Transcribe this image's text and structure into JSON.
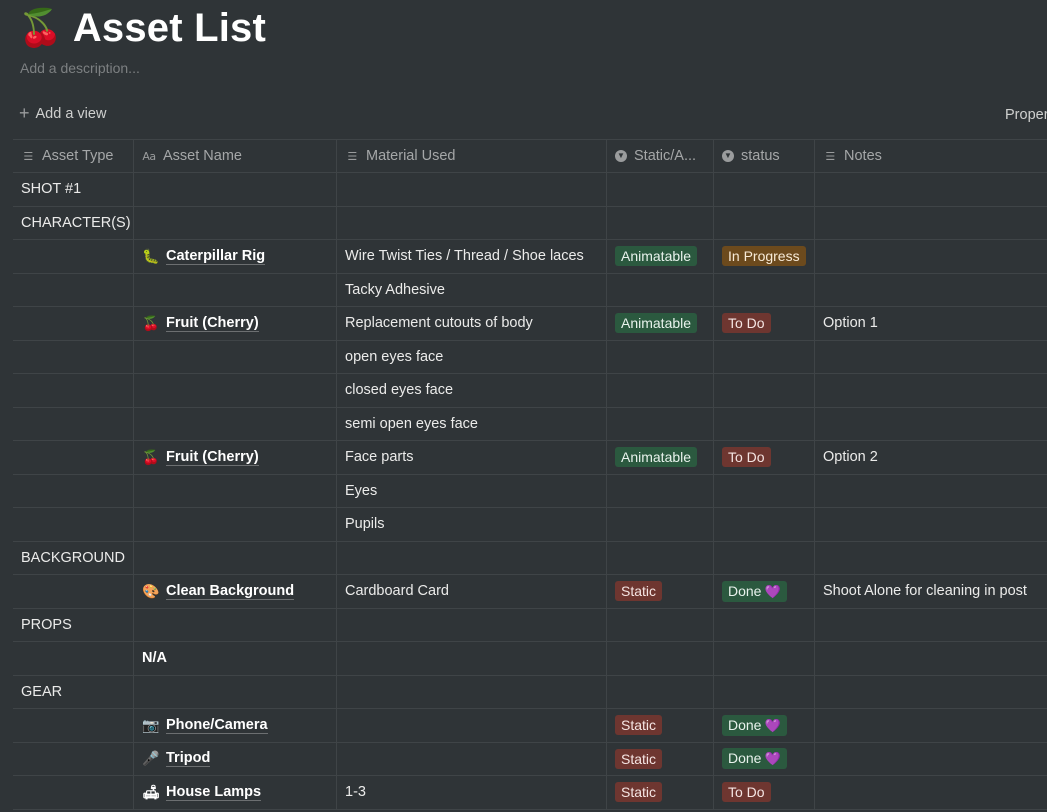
{
  "page": {
    "emoji": "🍒",
    "title": "Asset List",
    "description_placeholder": "Add a description...",
    "add_view": "Add a view",
    "properties": "Proper"
  },
  "columns": [
    {
      "label": "Asset Type",
      "icon": "text-lines-icon"
    },
    {
      "label": "Asset Name",
      "icon": "title-aa-icon"
    },
    {
      "label": "Material Used",
      "icon": "text-lines-icon"
    },
    {
      "label": "Static/A...",
      "icon": "select-chevron-icon"
    },
    {
      "label": "status",
      "icon": "select-chevron-icon"
    },
    {
      "label": "Notes",
      "icon": "text-lines-icon"
    }
  ],
  "rows": [
    {
      "type": "SHOT #1",
      "emoji": "",
      "name": "",
      "material": "",
      "static": "",
      "status": "",
      "notes": ""
    },
    {
      "type": "CHARACTER(S)",
      "emoji": "",
      "name": "",
      "material": "",
      "static": "",
      "status": "",
      "notes": ""
    },
    {
      "type": "",
      "emoji": "🐛",
      "name": "Caterpillar Rig",
      "material": "Wire Twist Ties / Thread / Shoe laces",
      "static": "Animatable",
      "status": "In Progress",
      "notes": ""
    },
    {
      "type": "",
      "emoji": "",
      "name": "",
      "material": "Tacky Adhesive",
      "static": "",
      "status": "",
      "notes": ""
    },
    {
      "type": "",
      "emoji": "🍒",
      "name": "Fruit (Cherry)",
      "material": "Replacement cutouts of body",
      "static": "Animatable",
      "status": "To Do",
      "notes": "Option 1"
    },
    {
      "type": "",
      "emoji": "",
      "name": "",
      "material": "open eyes face",
      "static": "",
      "status": "",
      "notes": ""
    },
    {
      "type": "",
      "emoji": "",
      "name": "",
      "material": "closed eyes face",
      "static": "",
      "status": "",
      "notes": ""
    },
    {
      "type": "",
      "emoji": "",
      "name": "",
      "material": "semi open eyes face",
      "static": "",
      "status": "",
      "notes": ""
    },
    {
      "type": "",
      "emoji": "🍒",
      "name": "Fruit (Cherry)",
      "material": "Face parts",
      "static": "Animatable",
      "status": "To Do",
      "notes": "Option 2"
    },
    {
      "type": "",
      "emoji": "",
      "name": "",
      "material": "Eyes",
      "static": "",
      "status": "",
      "notes": ""
    },
    {
      "type": "",
      "emoji": "",
      "name": "",
      "material": "Pupils",
      "static": "",
      "status": "",
      "notes": ""
    },
    {
      "type": "BACKGROUND",
      "emoji": "",
      "name": "",
      "material": "",
      "static": "",
      "status": "",
      "notes": ""
    },
    {
      "type": "",
      "emoji": "🎨",
      "name": "Clean Background",
      "material": "Cardboard Card",
      "static": "Static",
      "status": "Done",
      "status_heart": "💜",
      "notes": "Shoot Alone for cleaning in post"
    },
    {
      "type": "PROPS",
      "emoji": "",
      "name": "",
      "material": "",
      "static": "",
      "status": "",
      "notes": ""
    },
    {
      "type": "",
      "emoji": "",
      "name": "N/A",
      "material": "",
      "static": "",
      "status": "",
      "notes": ""
    },
    {
      "type": "GEAR",
      "emoji": "",
      "name": "",
      "material": "",
      "static": "",
      "status": "",
      "notes": ""
    },
    {
      "type": "",
      "emoji": "📷",
      "name": "Phone/Camera",
      "material": "",
      "static": "Static",
      "status": "Done",
      "status_heart": "💜",
      "notes": ""
    },
    {
      "type": "",
      "emoji": "🎤",
      "name": "Tripod",
      "material": "",
      "static": "Static",
      "status": "Done",
      "status_heart": "💜",
      "notes": ""
    },
    {
      "type": "",
      "emoji": "🛋",
      "name": "House Lamps",
      "material": "1-3",
      "static": "Static",
      "status": "To Do",
      "notes": ""
    }
  ],
  "colors": {
    "background": "#2f3437",
    "tag_green": "#2b593f",
    "tag_red": "#6e3630",
    "tag_orange": "#6c4a1d",
    "heart": "#a26ee6"
  }
}
